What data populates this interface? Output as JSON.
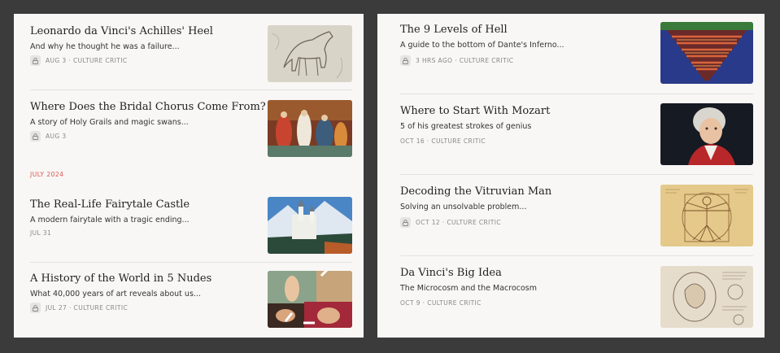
{
  "colors": {
    "background": "#3b3b3b",
    "panel": "#f8f7f5",
    "section_label": "#d9534f"
  },
  "left_panel": {
    "section_label": "JULY 2024",
    "posts": [
      {
        "title": "Leonardo da Vinci's Achilles' Heel",
        "subtitle": "And why he thought he was a failure...",
        "meta": "AUG 3 · CULTURE CRITIC",
        "locked": true,
        "thumbnail": "horse-sketch"
      },
      {
        "title": "Where Does the Bridal Chorus Come From?",
        "subtitle": "A story of Holy Grails and magic swans...",
        "meta": "AUG 3",
        "locked": true,
        "thumbnail": "bridal-painting"
      },
      {
        "title": "The Real-Life Fairytale Castle",
        "subtitle": "A modern fairytale with a tragic ending...",
        "meta": "JUL 31",
        "locked": false,
        "thumbnail": "neuschwanstein-castle"
      },
      {
        "title": "A History of the World in 5 Nudes",
        "subtitle": "What 40,000 years of art reveals about us...",
        "meta": "JUL 27 · CULTURE CRITIC",
        "locked": true,
        "thumbnail": "nudes-collage"
      }
    ]
  },
  "right_panel": {
    "posts": [
      {
        "title": "The 9 Levels of Hell",
        "subtitle": "A guide to the bottom of Dante's Inferno...",
        "meta": "3 HRS AGO · CULTURE CRITIC",
        "locked": true,
        "thumbnail": "dante-inferno-map"
      },
      {
        "title": "Where to Start With Mozart",
        "subtitle": "5 of his greatest strokes of genius",
        "meta": "OCT 16 · CULTURE CRITIC",
        "locked": false,
        "thumbnail": "mozart-portrait"
      },
      {
        "title": "Decoding the Vitruvian Man",
        "subtitle": "Solving an unsolvable problem...",
        "meta": "OCT 12 · CULTURE CRITIC",
        "locked": true,
        "thumbnail": "vitruvian-man"
      },
      {
        "title": "Da Vinci's Big Idea",
        "subtitle": "The Microcosm and the Macrocosm",
        "meta": "OCT 9 · CULTURE CRITIC",
        "locked": false,
        "thumbnail": "fetus-drawing"
      }
    ]
  }
}
